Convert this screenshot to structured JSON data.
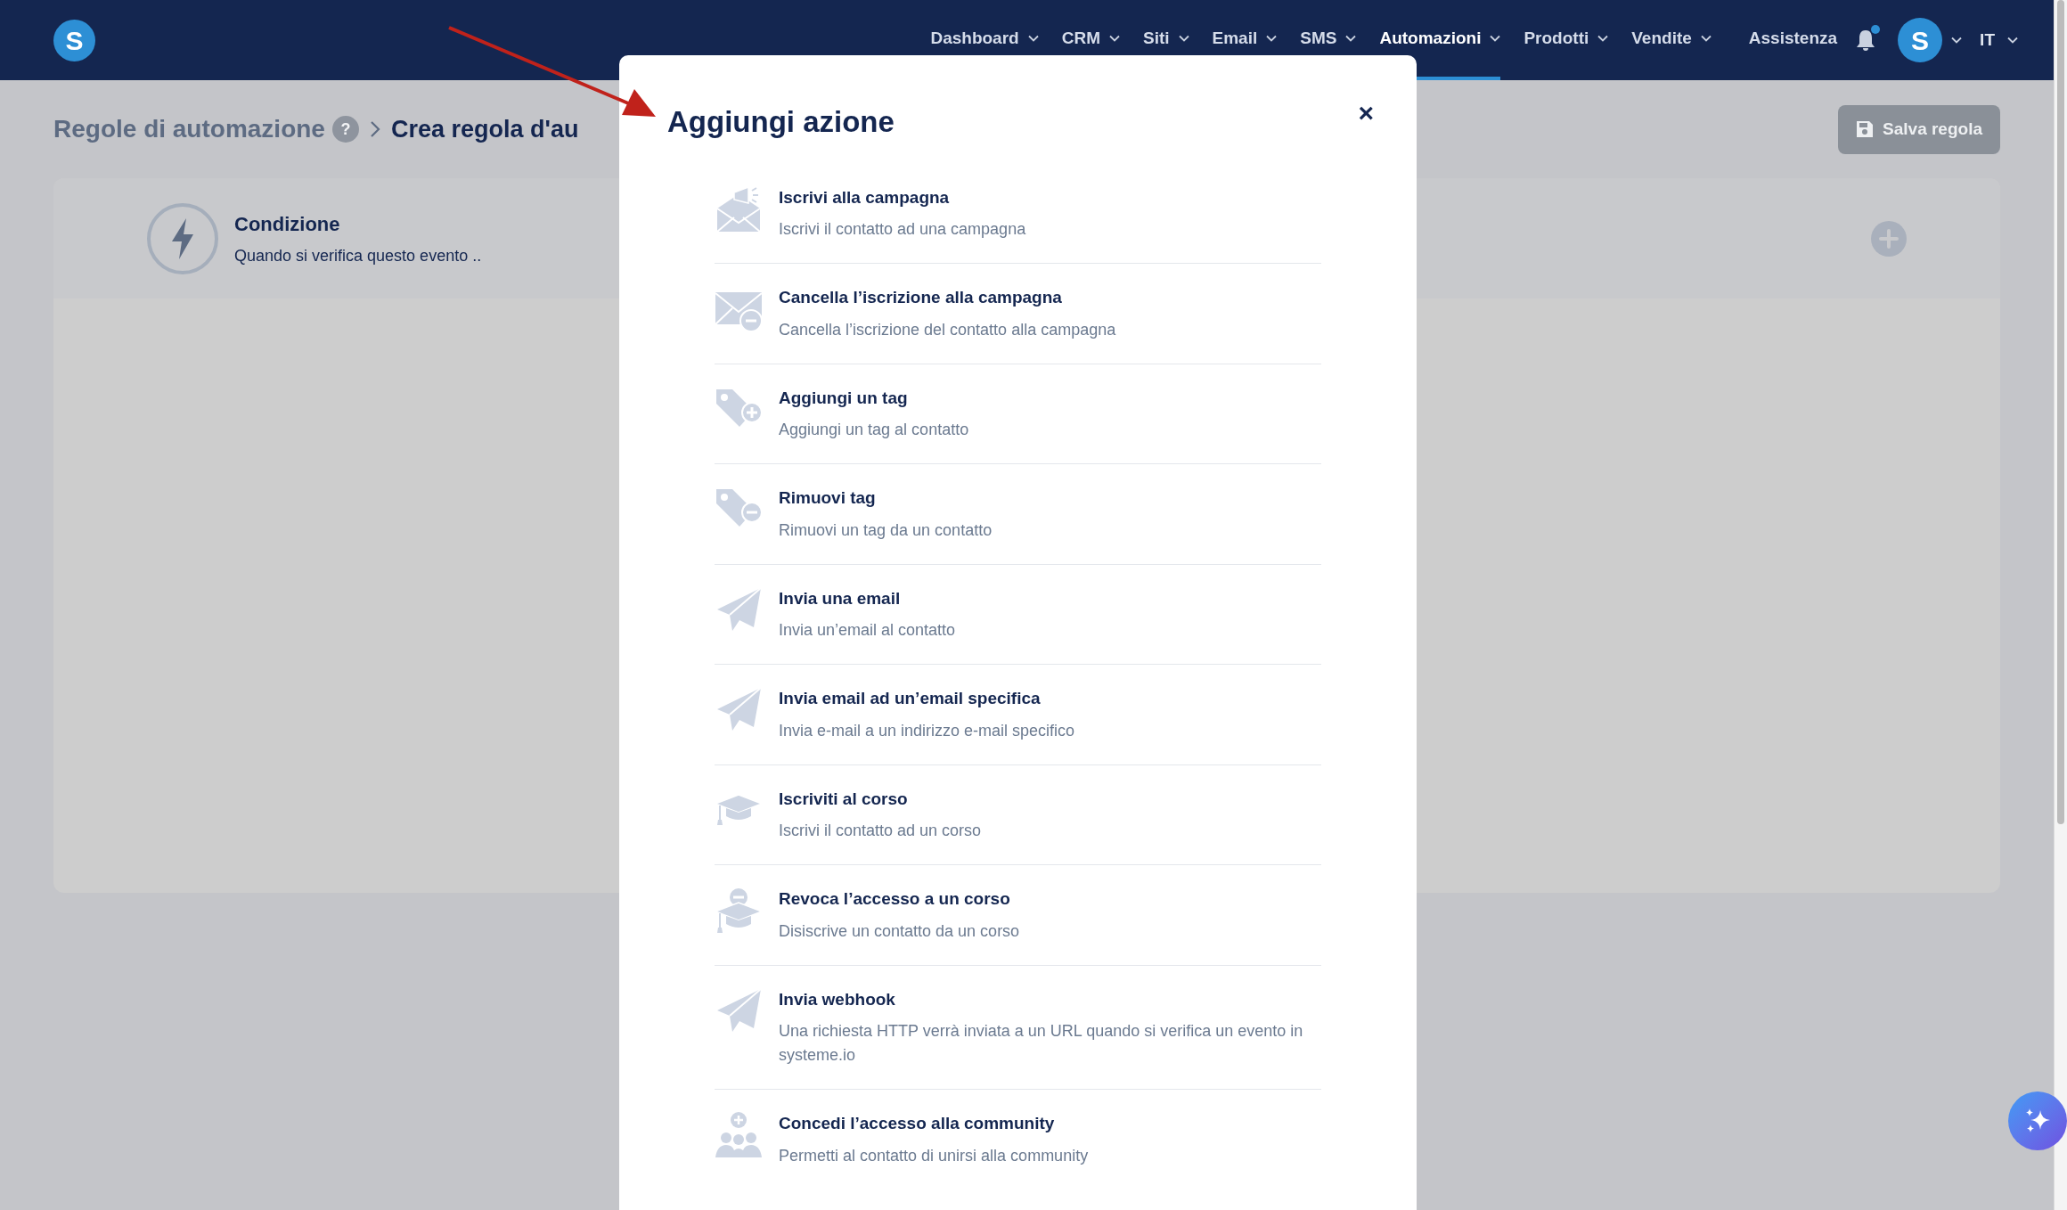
{
  "logo": {
    "letter": "S"
  },
  "nav": {
    "items": [
      {
        "label": "Dashboard",
        "selected": false,
        "dropdown": true
      },
      {
        "label": "CRM",
        "selected": false,
        "dropdown": true
      },
      {
        "label": "Siti",
        "selected": false,
        "dropdown": true
      },
      {
        "label": "Email",
        "selected": false,
        "dropdown": true
      },
      {
        "label": "SMS",
        "selected": false,
        "dropdown": true
      },
      {
        "label": "Automazioni",
        "selected": true,
        "dropdown": true
      },
      {
        "label": "Prodotti",
        "selected": false,
        "dropdown": true
      },
      {
        "label": "Vendite",
        "selected": false,
        "dropdown": true
      },
      {
        "label": "Assistenza",
        "selected": false,
        "dropdown": false
      }
    ],
    "notifications_unread": true,
    "avatar_letter": "S",
    "language": "IT"
  },
  "breadcrumb": {
    "parent": "Regole di automazione",
    "help": "?",
    "current": "Crea regola d'au"
  },
  "save_button": {
    "label": "Salva regola"
  },
  "condition": {
    "title": "Condizione",
    "subtitle": "Quando si verifica questo evento .."
  },
  "modal": {
    "title": "Aggiungi azione",
    "close": "×",
    "actions": [
      {
        "kind": "campaign",
        "title": "Iscrivi alla campagna",
        "description": "Iscrivi il contatto ad una campagna"
      },
      {
        "kind": "unsubscribe",
        "title": "Cancella l’iscrizione alla campagna",
        "description": "Cancella l’iscrizione del contatto alla campagna"
      },
      {
        "kind": "tag_add",
        "title": "Aggiungi un tag",
        "description": "Aggiungi un tag al contatto"
      },
      {
        "kind": "tag_remove",
        "title": "Rimuovi tag",
        "description": "Rimuovi un tag da un contatto"
      },
      {
        "kind": "send",
        "title": "Invia una email",
        "description": "Invia un’email al contatto"
      },
      {
        "kind": "send",
        "title": "Invia email ad un’email specifica",
        "description": "Invia e-mail a un indirizzo e-mail specifico"
      },
      {
        "kind": "course",
        "title": "Iscriviti al corso",
        "description": "Iscrivi il contatto ad un corso"
      },
      {
        "kind": "course_remove",
        "title": "Revoca l’accesso a un corso",
        "description": "Disiscrive un contatto da un corso"
      },
      {
        "kind": "send",
        "title": "Invia webhook",
        "description": "Una richiesta HTTP verrà inviata a un URL quando si verifica un evento in systeme.io"
      },
      {
        "kind": "community",
        "title": "Concedi l’accesso alla community",
        "description": "Permetti al contatto di unirsi alla community"
      }
    ]
  }
}
